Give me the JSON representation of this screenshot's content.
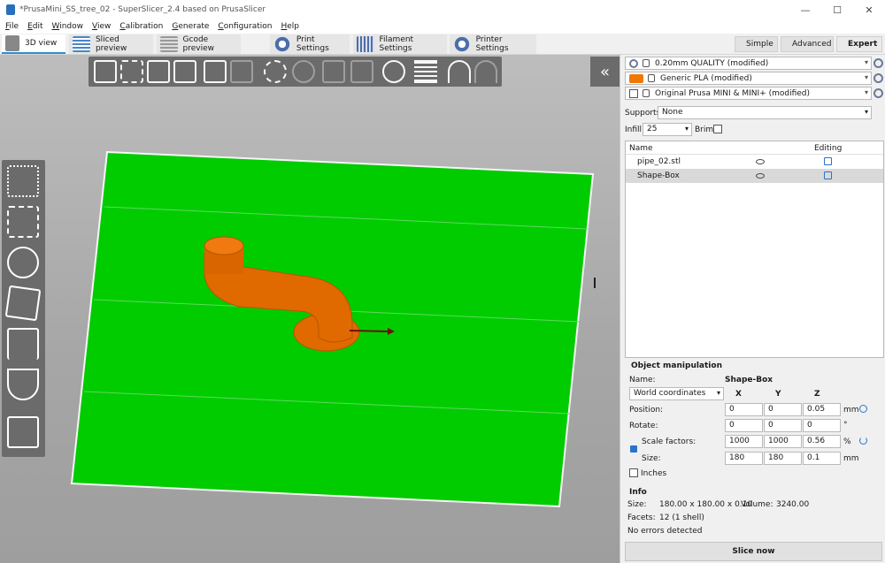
{
  "window": {
    "title": "*PrusaMini_SS_tree_02 - SuperSlicer_2.4  based on PrusaSlicer",
    "controls": [
      "—",
      "☐",
      "✕"
    ]
  },
  "menu": [
    "File",
    "Edit",
    "Window",
    "View",
    "Calibration",
    "Generate",
    "Configuration",
    "Help"
  ],
  "tabs": [
    {
      "label": "3D view",
      "active": true
    },
    {
      "label": "Sliced preview"
    },
    {
      "label": "Gcode preview"
    },
    {
      "label": "Print Settings"
    },
    {
      "label": "Filament Settings"
    },
    {
      "label": "Printer Settings"
    }
  ],
  "modes": [
    {
      "label": "Simple",
      "color": "#2ebd2e"
    },
    {
      "label": "Advanced",
      "color": "#e6c200"
    },
    {
      "label": "Expert",
      "color": "#d40000",
      "active": true
    }
  ],
  "colors": {
    "bed": "#00cc00",
    "object": "#e06a00",
    "filament": "#f07800",
    "accent": "#2b8fd4"
  },
  "presets": {
    "print": "0.20mm QUALITY (modified)",
    "filament": "Generic PLA (modified)",
    "printer": "Original Prusa MINI & MINI+ (modified)"
  },
  "supports": {
    "label": "Supports:",
    "value": "None"
  },
  "infill": {
    "label": "Infill:",
    "value": "25"
  },
  "brim": {
    "label": "Brim:",
    "checked": false
  },
  "object_list": {
    "headers": {
      "name": "Name",
      "editing": "Editing"
    },
    "rows": [
      {
        "name": "pipe_02.stl",
        "selected": false
      },
      {
        "name": "Shape-Box",
        "selected": true
      }
    ]
  },
  "manipulation": {
    "title": "Object manipulation",
    "name_label": "Name:",
    "name_value": "Shape-Box",
    "coord_system": "World coordinates",
    "axes": [
      "X",
      "Y",
      "Z"
    ],
    "rows": [
      {
        "label": "Position:",
        "values": [
          "0",
          "0",
          "0.05"
        ],
        "unit": "mm"
      },
      {
        "label": "Rotate:",
        "values": [
          "0",
          "0",
          "0"
        ],
        "unit": "°"
      },
      {
        "label": "Scale factors:",
        "values": [
          "1000",
          "1000",
          "0.56"
        ],
        "unit": "%"
      },
      {
        "label": "Size:",
        "values": [
          "180",
          "180",
          "0.1"
        ],
        "unit": "mm"
      }
    ],
    "inches_label": "Inches"
  },
  "info": {
    "title": "Info",
    "size_label": "Size:",
    "size_value": "180.00 x 180.00 x 0.10",
    "volume_label": "Volume:",
    "volume_value": "3240.00",
    "facets_label": "Facets:",
    "facets_value": "12 (1 shell)",
    "errors": "No errors detected"
  },
  "slice_button": "Slice now"
}
